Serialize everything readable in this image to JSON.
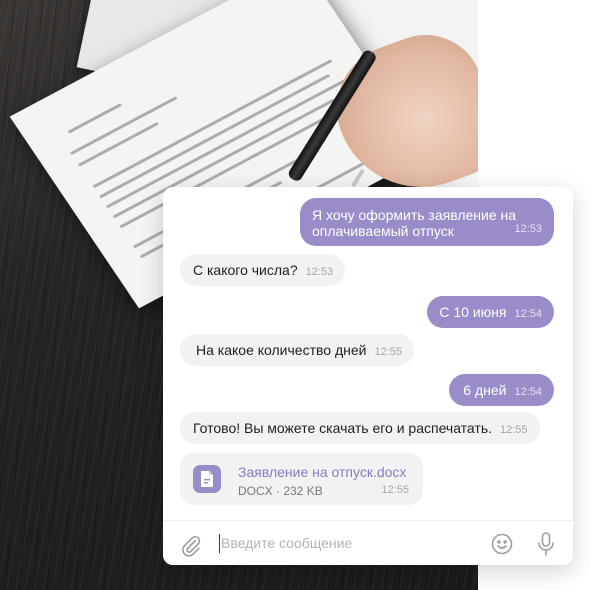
{
  "messages": [
    {
      "direction": "out",
      "text": "Я хочу оформить заявление на оплачиваемый отпуск",
      "time": "12:53"
    },
    {
      "direction": "in",
      "text": "С какого числа?",
      "time": "12:53"
    },
    {
      "direction": "out",
      "text": "С 10 июня",
      "time": "12:54"
    },
    {
      "direction": "in",
      "text": "На какое количество дней",
      "time": "12:55"
    },
    {
      "direction": "out",
      "text": "6 дней",
      "time": "12:54"
    },
    {
      "direction": "in",
      "text": "Готово! Вы можете скачать его и распечатать.",
      "time": "12:55"
    }
  ],
  "attachment": {
    "name": "Заявление на отпуск.docx",
    "meta": "DOCX · 232 KB",
    "time": "12:55",
    "icon": "document-icon"
  },
  "composer": {
    "placeholder": "Введите сообщение",
    "value": "",
    "icons": [
      "paperclip-icon",
      "emoji-icon",
      "microphone-icon"
    ]
  },
  "colors": {
    "accent": "#9a8cc8",
    "incoming_bubble": "#f2f2f2",
    "file_name": "#8a7ac0"
  }
}
